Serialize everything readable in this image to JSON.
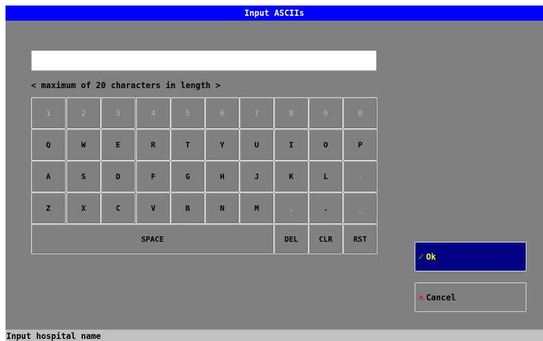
{
  "window": {
    "title": "Input ASCIIs"
  },
  "input": {
    "value": "",
    "placeholder": ""
  },
  "hint": "< maximum of 20 characters in length >",
  "keyboard": {
    "rows": [
      [
        {
          "label": "1",
          "enabled": false
        },
        {
          "label": "2",
          "enabled": false
        },
        {
          "label": "3",
          "enabled": false
        },
        {
          "label": "4",
          "enabled": false
        },
        {
          "label": "5",
          "enabled": false
        },
        {
          "label": "6",
          "enabled": false
        },
        {
          "label": "7",
          "enabled": false
        },
        {
          "label": "8",
          "enabled": false
        },
        {
          "label": "9",
          "enabled": false
        },
        {
          "label": "0",
          "enabled": false
        }
      ],
      [
        {
          "label": "Q",
          "enabled": true
        },
        {
          "label": "W",
          "enabled": true
        },
        {
          "label": "E",
          "enabled": true
        },
        {
          "label": "R",
          "enabled": true
        },
        {
          "label": "T",
          "enabled": true
        },
        {
          "label": "Y",
          "enabled": true
        },
        {
          "label": "U",
          "enabled": true
        },
        {
          "label": "I",
          "enabled": true
        },
        {
          "label": "O",
          "enabled": true
        },
        {
          "label": "P",
          "enabled": true
        }
      ],
      [
        {
          "label": "A",
          "enabled": true
        },
        {
          "label": "S",
          "enabled": true
        },
        {
          "label": "D",
          "enabled": true
        },
        {
          "label": "F",
          "enabled": true
        },
        {
          "label": "G",
          "enabled": true
        },
        {
          "label": "H",
          "enabled": true
        },
        {
          "label": "J",
          "enabled": true
        },
        {
          "label": "K",
          "enabled": true
        },
        {
          "label": "L",
          "enabled": true
        },
        {
          "label": "-",
          "enabled": false
        }
      ],
      [
        {
          "label": "Z",
          "enabled": true
        },
        {
          "label": "X",
          "enabled": true
        },
        {
          "label": "C",
          "enabled": true
        },
        {
          "label": "V",
          "enabled": true
        },
        {
          "label": "B",
          "enabled": true
        },
        {
          "label": "N",
          "enabled": true
        },
        {
          "label": "M",
          "enabled": true
        },
        {
          "label": ",",
          "enabled": false
        },
        {
          "label": ".",
          "enabled": true
        },
        {
          "label": "_",
          "enabled": false
        }
      ]
    ],
    "space_label": "SPACE",
    "del_label": "DEL",
    "clr_label": "CLR",
    "rst_label": "RST"
  },
  "buttons": {
    "ok_icon": "checkmark-icon",
    "ok_symbol": "✓",
    "ok_label": "Ok",
    "cancel_icon": "cross-icon",
    "cancel_symbol": "✕",
    "cancel_label": "Cancel"
  },
  "status": "Input hospital name",
  "colors": {
    "title_bar": "#0000ff",
    "background": "#808080",
    "ok_button": "#000080",
    "ok_text": "#ffff00",
    "check": "#00c000",
    "cross": "#ff0000"
  }
}
